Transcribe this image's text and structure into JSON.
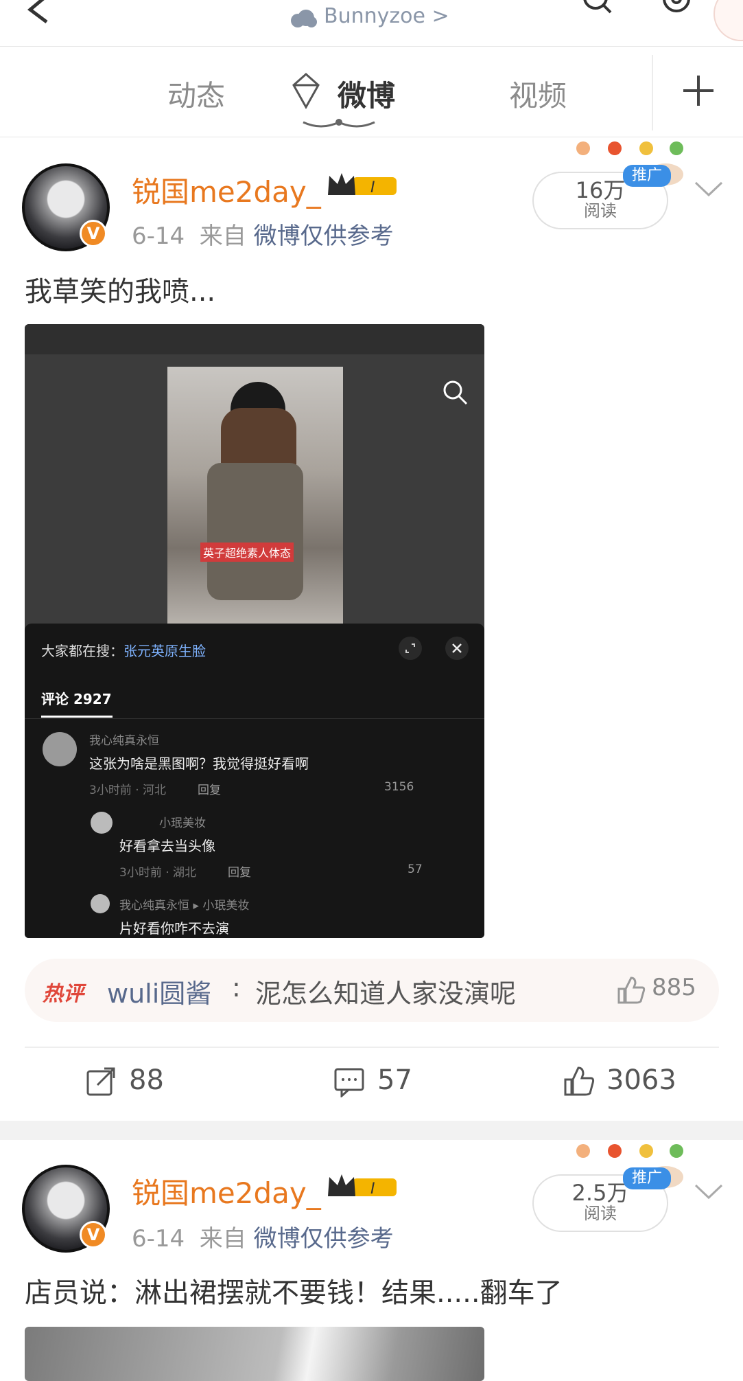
{
  "header": {
    "subtitle": "Bunnyzoe >",
    "icons": [
      "back-icon",
      "search-icon",
      "settings-icon"
    ]
  },
  "tabs": [
    {
      "label": "动态"
    },
    {
      "label": "微博"
    },
    {
      "label": "视频"
    }
  ],
  "posts": [
    {
      "username": "锐国me2day_",
      "date": "6-14",
      "from_label": "来自",
      "source": "微博仅供参考",
      "reads": "16万",
      "reads_label": "阅读",
      "promo": "推广",
      "text": "我草笑的我喷...",
      "media": {
        "overlay_text": "英子超绝素人体态",
        "search_prefix": "大家都在搜：",
        "search_term": "张元英原生脸",
        "comment_tab": "评论 2927",
        "comments": [
          {
            "user": "我心纯真永恒",
            "text": "这张为啥是黑图啊？我觉得挺好看啊",
            "time": "3小时前 · 河北",
            "reply": "回复",
            "likes": "3156"
          },
          {
            "user": "小珉美妆",
            "text": "好看拿去当头像",
            "time": "3小时前 · 湖北",
            "reply": "回复",
            "likes": "57"
          },
          {
            "user": "我心纯真永恒 ▸ 小珉美妆",
            "text": "片好看你咋不去演",
            "time": "",
            "reply": "",
            "likes": ""
          }
        ]
      },
      "hot_comment": {
        "tag": "热评",
        "user": "wuli圆酱",
        "text": "泥怎么知道人家没演呢",
        "likes": "885"
      },
      "actions": {
        "reposts": "88",
        "comments": "57",
        "likes": "3063"
      }
    },
    {
      "username": "锐国me2day_",
      "date": "6-14",
      "from_label": "来自",
      "source": "微博仅供参考",
      "reads": "2.5万",
      "reads_label": "阅读",
      "promo": "推广",
      "text": "店员说：淋出裙摆就不要钱！结果.....翻车了"
    }
  ],
  "colors": {
    "accent": "#e8781f",
    "link": "#58698c",
    "hot": "#e0473a",
    "promo": "#3b8fe6"
  }
}
